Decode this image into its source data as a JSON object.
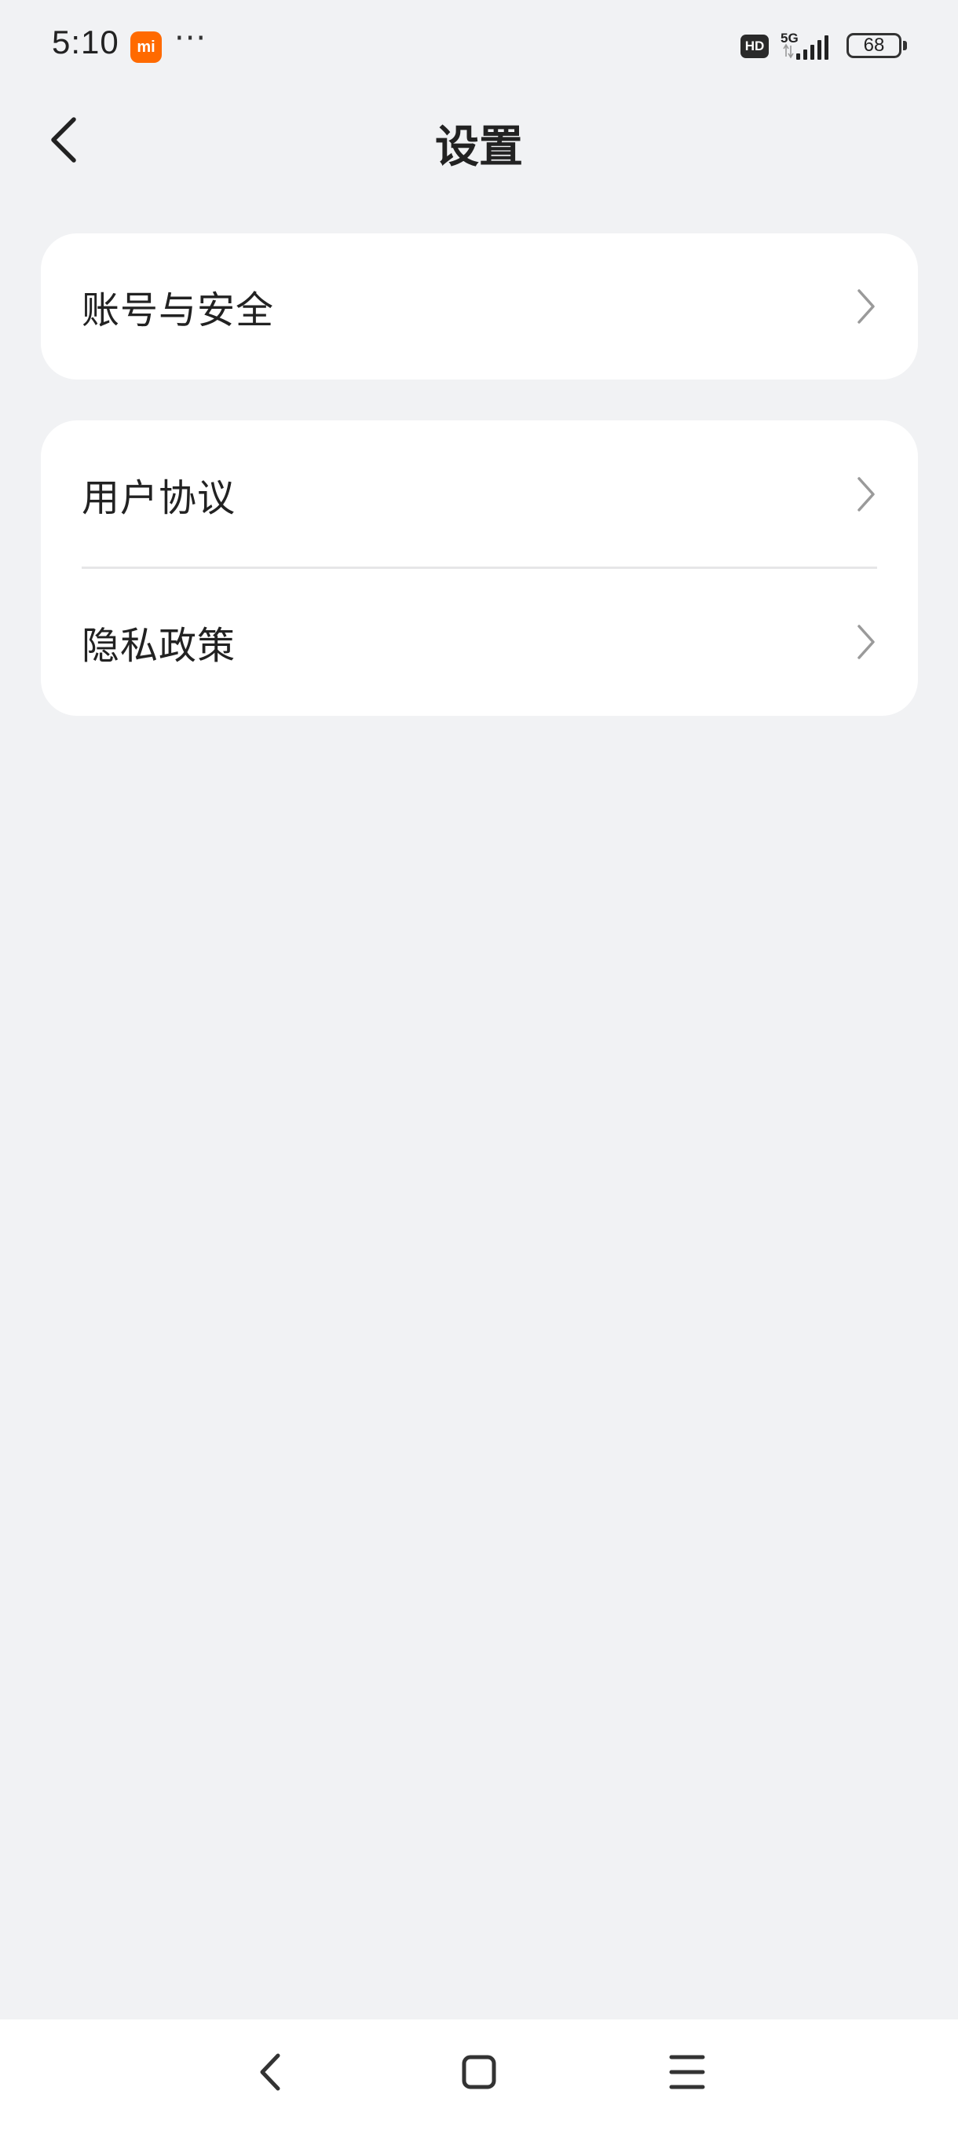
{
  "status_bar": {
    "time": "5:10",
    "app_badge": "mi",
    "more": "···",
    "hd_label": "HD",
    "network_type": "5G",
    "battery": "68"
  },
  "header": {
    "title": "设置",
    "back_icon": "chevron-left-icon"
  },
  "settings": {
    "group1": [
      {
        "label": "账号与安全",
        "icon": "chevron-right-icon"
      }
    ],
    "group2": [
      {
        "label": "用户协议",
        "icon": "chevron-right-icon"
      },
      {
        "label": "隐私政策",
        "icon": "chevron-right-icon"
      }
    ]
  },
  "nav_bar": {
    "back_icon": "nav-back-icon",
    "home_icon": "nav-home-icon",
    "menu_icon": "nav-menu-icon"
  },
  "colors": {
    "background": "#f1f2f4",
    "card": "#ffffff",
    "text": "#222222",
    "chevron": "#9a9a9a",
    "brand_orange": "#ff6a00"
  }
}
